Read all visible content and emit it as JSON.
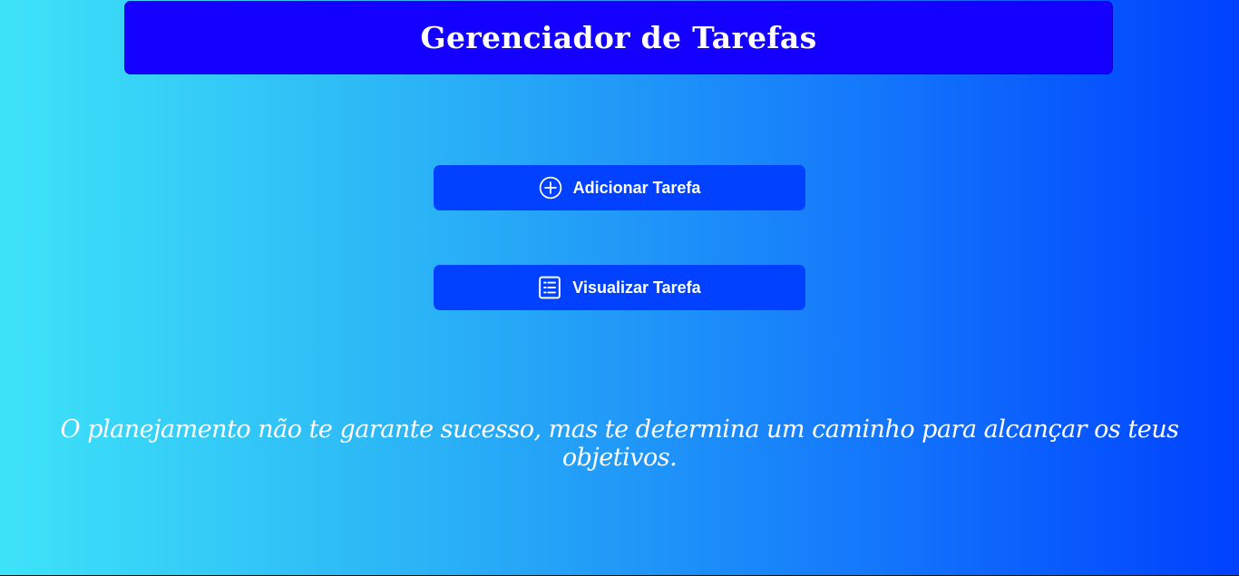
{
  "header": {
    "title": "Gerenciador de Tarefas"
  },
  "actions": {
    "add_label": "Adicionar Tarefa",
    "add_icon": "plus-circle-icon",
    "view_label": "Visualizar Tarefa",
    "view_icon": "list-icon"
  },
  "quote": {
    "text": "O planejamento não te garante sucesso, mas te determina um caminho para alcançar os teus objetivos."
  },
  "colors": {
    "header_bg": "#1400ff",
    "button_bg": "#0040ff",
    "gradient_start": "#3ee3f8",
    "gradient_end": "#0041ff",
    "text": "#ffffff"
  }
}
